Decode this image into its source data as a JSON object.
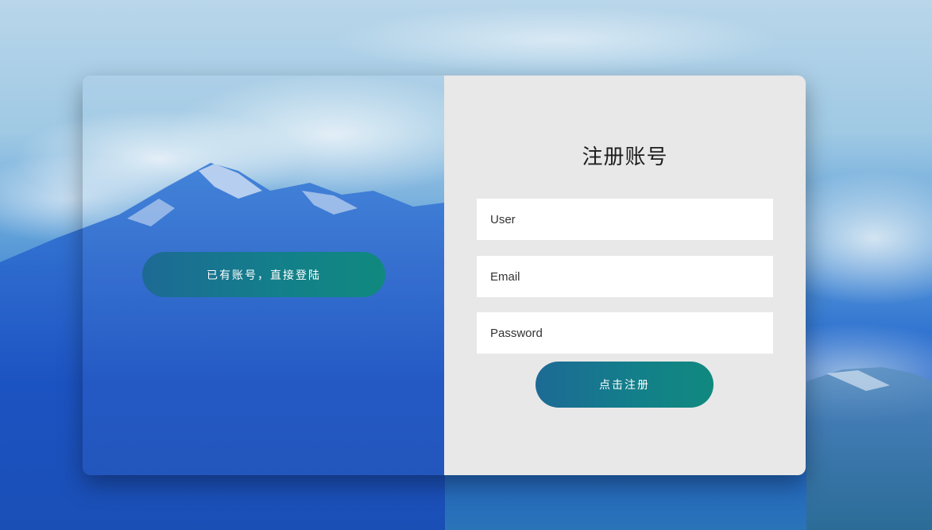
{
  "left_panel": {
    "login_button_label": "已有账号，直接登陆"
  },
  "register_form": {
    "title": "注册账号",
    "user_placeholder": "User",
    "email_placeholder": "Email",
    "password_placeholder": "Password",
    "submit_label": "点击注册"
  },
  "colors": {
    "button_gradient_start": "#1d6a95",
    "button_gradient_end": "#10897f",
    "card_background": "#e8e8e8",
    "sky_top": "#b9d6ea",
    "mountain_blue": "#1f5dc4"
  }
}
